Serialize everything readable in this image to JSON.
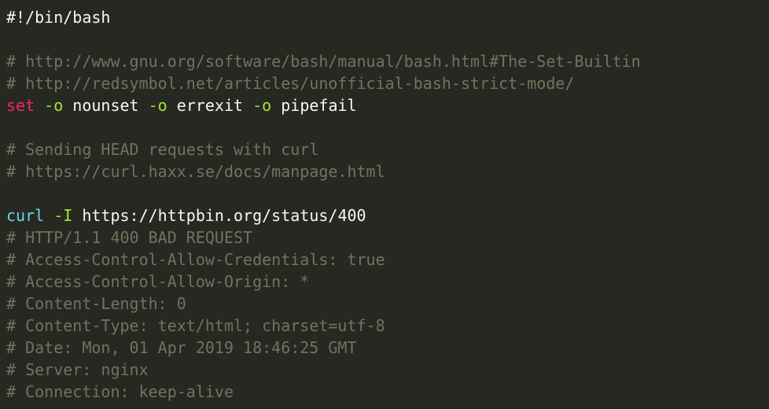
{
  "editor": {
    "language": "bash",
    "colors": {
      "background": "#272822",
      "default": "#f8f8f2",
      "comment": "#75715e",
      "keyword": "#f92672",
      "flag": "#a6e22e",
      "builtin": "#66d9ef"
    },
    "lines": [
      {
        "tokens": [
          {
            "type": "default",
            "text": "#!/bin/bash"
          }
        ]
      },
      {
        "tokens": []
      },
      {
        "tokens": [
          {
            "type": "comment",
            "text": "# http://www.gnu.org/software/bash/manual/bash.html#The-Set-Builtin"
          }
        ]
      },
      {
        "tokens": [
          {
            "type": "comment",
            "text": "# http://redsymbol.net/articles/unofficial-bash-strict-mode/"
          }
        ]
      },
      {
        "tokens": [
          {
            "type": "keyword",
            "text": "set"
          },
          {
            "type": "default",
            "text": " "
          },
          {
            "type": "flag",
            "text": "-o"
          },
          {
            "type": "default",
            "text": " nounset "
          },
          {
            "type": "flag",
            "text": "-o"
          },
          {
            "type": "default",
            "text": " errexit "
          },
          {
            "type": "flag",
            "text": "-o"
          },
          {
            "type": "default",
            "text": " pipefail"
          }
        ]
      },
      {
        "tokens": []
      },
      {
        "tokens": [
          {
            "type": "comment",
            "text": "# Sending HEAD requests with curl"
          }
        ]
      },
      {
        "tokens": [
          {
            "type": "comment",
            "text": "# https://curl.haxx.se/docs/manpage.html"
          }
        ]
      },
      {
        "tokens": []
      },
      {
        "tokens": [
          {
            "type": "builtin",
            "text": "curl"
          },
          {
            "type": "default",
            "text": " "
          },
          {
            "type": "flag",
            "text": "-I"
          },
          {
            "type": "default",
            "text": " https://httpbin.org/status/400"
          }
        ]
      },
      {
        "tokens": [
          {
            "type": "comment",
            "text": "# HTTP/1.1 400 BAD REQUEST"
          }
        ]
      },
      {
        "tokens": [
          {
            "type": "comment",
            "text": "# Access-Control-Allow-Credentials: true"
          }
        ]
      },
      {
        "tokens": [
          {
            "type": "comment",
            "text": "# Access-Control-Allow-Origin: *"
          }
        ]
      },
      {
        "tokens": [
          {
            "type": "comment",
            "text": "# Content-Length: 0"
          }
        ]
      },
      {
        "tokens": [
          {
            "type": "comment",
            "text": "# Content-Type: text/html; charset=utf-8"
          }
        ]
      },
      {
        "tokens": [
          {
            "type": "comment",
            "text": "# Date: Mon, 01 Apr 2019 18:46:25 GMT"
          }
        ]
      },
      {
        "tokens": [
          {
            "type": "comment",
            "text": "# Server: nginx"
          }
        ]
      },
      {
        "tokens": [
          {
            "type": "comment",
            "text": "# Connection: keep-alive"
          }
        ]
      }
    ]
  }
}
